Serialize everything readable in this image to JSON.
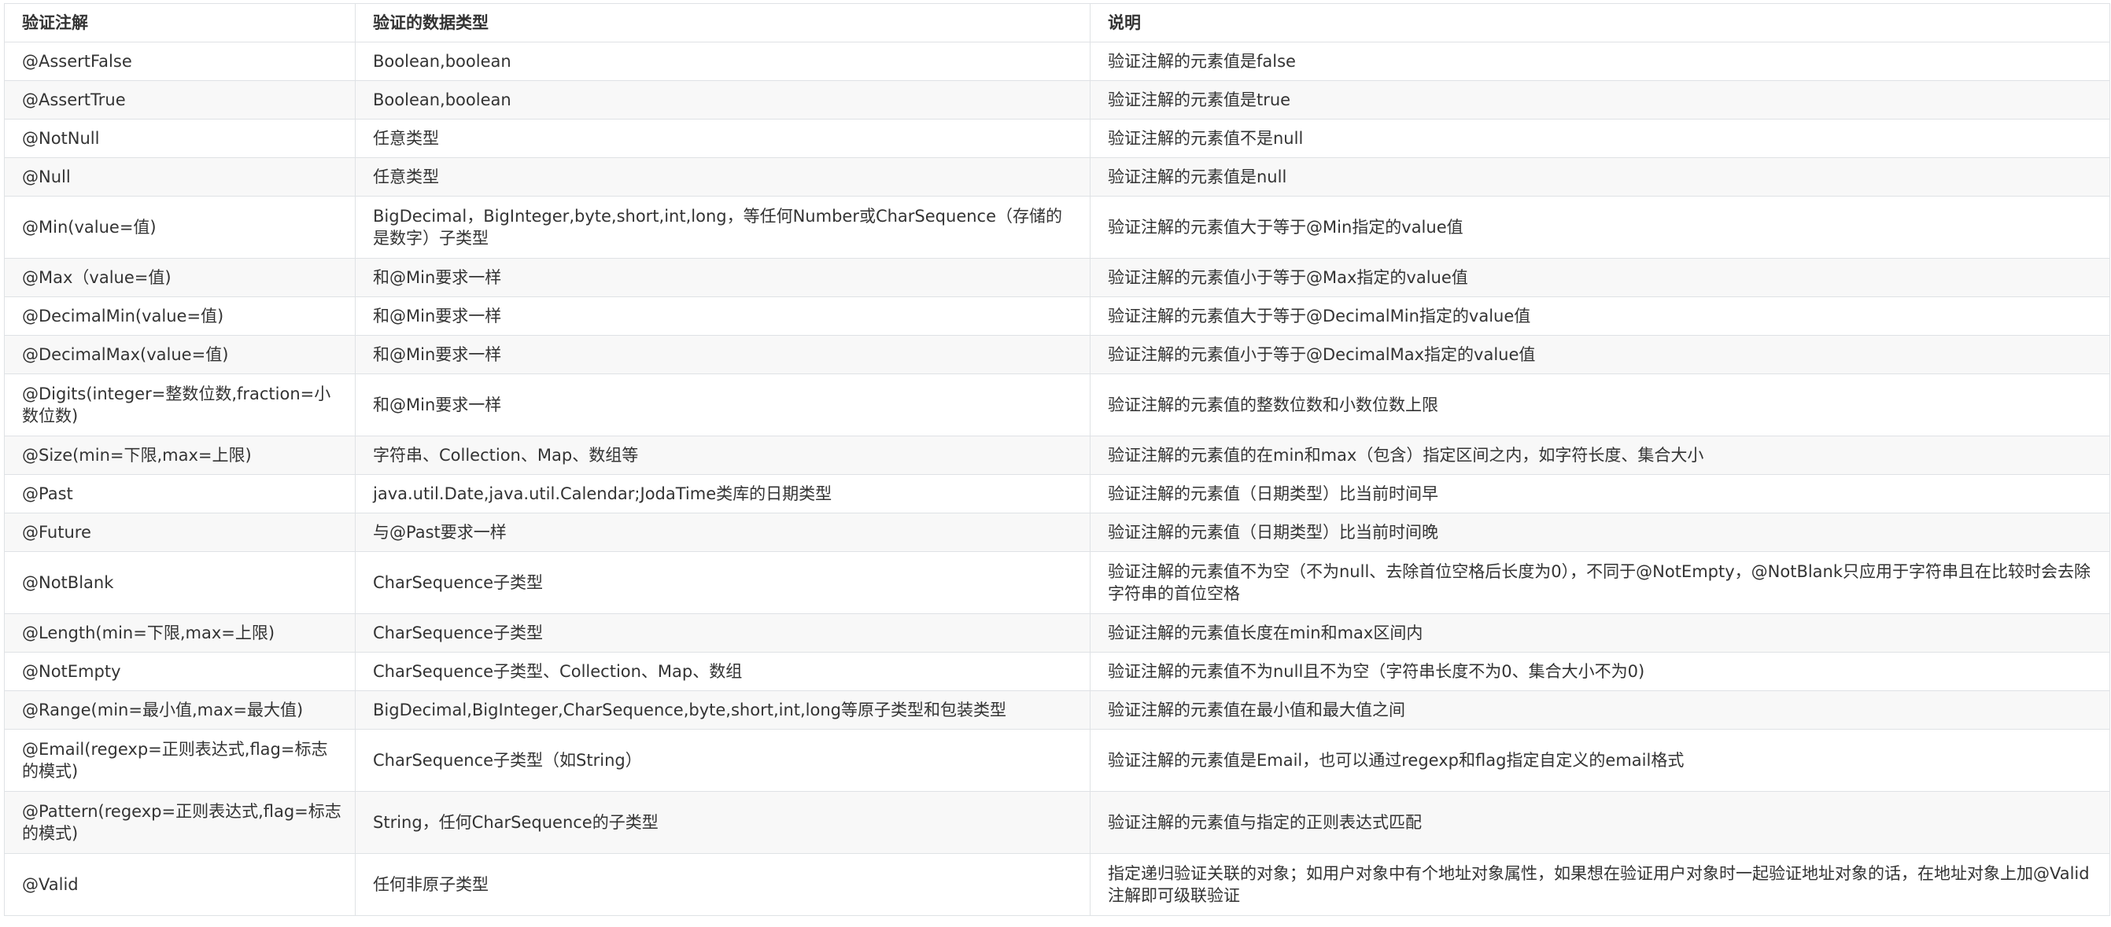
{
  "headers": [
    "验证注解",
    "验证的数据类型",
    "说明"
  ],
  "rows": [
    [
      "@AssertFalse",
      "Boolean,boolean",
      "验证注解的元素值是false"
    ],
    [
      "@AssertTrue",
      "Boolean,boolean",
      "验证注解的元素值是true"
    ],
    [
      "@NotNull",
      "任意类型",
      "验证注解的元素值不是null"
    ],
    [
      "@Null",
      "任意类型",
      "验证注解的元素值是null"
    ],
    [
      "@Min(value=值)",
      "BigDecimal，BigInteger,byte,short,int,long，等任何Number或CharSequence（存储的是数字）子类型",
      "验证注解的元素值大于等于@Min指定的value值"
    ],
    [
      "@Max（value=值)",
      "和@Min要求一样",
      "验证注解的元素值小于等于@Max指定的value值"
    ],
    [
      "@DecimalMin(value=值)",
      "和@Min要求一样",
      "验证注解的元素值大于等于@DecimalMin指定的value值"
    ],
    [
      "@DecimalMax(value=值)",
      "和@Min要求一样",
      "验证注解的元素值小于等于@DecimalMax指定的value值"
    ],
    [
      "@Digits(integer=整数位数,fraction=小数位数)",
      "和@Min要求一样",
      "验证注解的元素值的整数位数和小数位数上限"
    ],
    [
      "@Size(min=下限,max=上限)",
      "字符串、Collection、Map、数组等",
      "验证注解的元素值的在min和max（包含）指定区间之内，如字符长度、集合大小"
    ],
    [
      "@Past",
      "java.util.Date,java.util.Calendar;JodaTime类库的日期类型",
      "验证注解的元素值（日期类型）比当前时间早"
    ],
    [
      "@Future",
      "与@Past要求一样",
      "验证注解的元素值（日期类型）比当前时间晚"
    ],
    [
      "@NotBlank",
      "CharSequence子类型",
      "验证注解的元素值不为空（不为null、去除首位空格后长度为0），不同于@NotEmpty，@NotBlank只应用于字符串且在比较时会去除字符串的首位空格"
    ],
    [
      "@Length(min=下限,max=上限)",
      "CharSequence子类型",
      "验证注解的元素值长度在min和max区间内"
    ],
    [
      "@NotEmpty",
      "CharSequence子类型、Collection、Map、数组",
      "验证注解的元素值不为null且不为空（字符串长度不为0、集合大小不为0)"
    ],
    [
      "@Range(min=最小值,max=最大值)",
      "BigDecimal,BigInteger,CharSequence,byte,short,int,long等原子类型和包装类型",
      "验证注解的元素值在最小值和最大值之间"
    ],
    [
      "@Email(regexp=正则表达式,flag=标志的模式)",
      "CharSequence子类型（如String）",
      "验证注解的元素值是Email，也可以通过regexp和flag指定自定义的email格式"
    ],
    [
      "@Pattern(regexp=正则表达式,flag=标志的模式)",
      "String，任何CharSequence的子类型",
      "验证注解的元素值与指定的正则表达式匹配"
    ],
    [
      "@Valid",
      "任何非原子类型",
      "指定递归验证关联的对象；如用户对象中有个地址对象属性，如果想在验证用户对象时一起验证地址对象的话，在地址对象上加@Valid注解即可级联验证"
    ]
  ]
}
